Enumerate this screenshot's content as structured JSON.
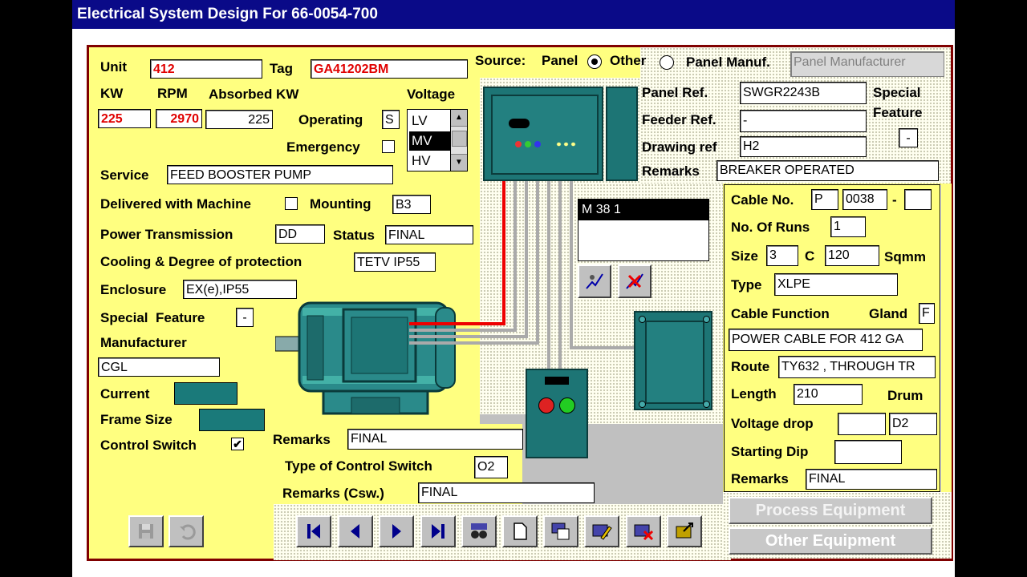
{
  "window": {
    "title": "Electrical System Design For 66-0054-700"
  },
  "motor": {
    "unit_label": "Unit",
    "unit": "412",
    "tag_label": "Tag",
    "tag": "GA41202BM",
    "kw_label": "KW",
    "kw": "225",
    "rpm_label": "RPM",
    "rpm": "2970",
    "absorbed_label": "Absorbed KW",
    "absorbed": "225",
    "voltage_label": "Voltage",
    "voltage_options": [
      "LV",
      "MV",
      "HV"
    ],
    "voltage_selected": "MV",
    "operating_label": "Operating",
    "operating": "S",
    "emergency_label": "Emergency",
    "service_label": "Service",
    "service": "FEED BOOSTER PUMP",
    "delivered_label": "Delivered with Machine",
    "mounting_label": "Mounting",
    "mounting": "B3",
    "power_trans_label": "Power Transmission",
    "power_trans": "DD",
    "status_label": "Status",
    "status": "FINAL",
    "cooling_label": "Cooling & Degree of protection",
    "cooling": "TETV IP55",
    "enclosure_label": "Enclosure",
    "enclosure": "EX(e),IP55",
    "special_feature_label": "Special  Feature",
    "special_feature": "-",
    "manufacturer_label": "Manufacturer",
    "manufacturer": "CGL",
    "current_label": "Current",
    "frame_size_label": "Frame Size",
    "control_switch_label": "Control Switch",
    "control_switch_checked": "✔",
    "remarks_label": "Remarks",
    "remarks": "FINAL",
    "type_csw_label": "Type of Control Switch",
    "type_csw": "O2",
    "remarks_csw_label": "Remarks (Csw.)",
    "remarks_csw": "FINAL"
  },
  "source": {
    "label": "Source:",
    "panel_label": "Panel",
    "other_label": "Other",
    "selected": "Panel",
    "panel_manuf_label": "Panel Manuf.",
    "panel_manuf_placeholder": "Panel Manufacturer"
  },
  "panel": {
    "panel_ref_label": "Panel Ref.",
    "panel_ref": "SWGR2243B",
    "feeder_ref_label": "Feeder Ref.",
    "feeder_ref": "-",
    "drawing_ref_label": "Drawing ref",
    "drawing_ref": "H2",
    "remarks_label": "Remarks",
    "remarks": "BREAKER OPERATED",
    "special_feature_label_1": "Special",
    "special_feature_label_2": "Feature",
    "special_feature": "-"
  },
  "list": {
    "items": [
      "M 38 1"
    ]
  },
  "cable": {
    "cable_no_label": "Cable No.",
    "cable_no_prefix": "P",
    "cable_no": "0038",
    "cable_no_sep": "-",
    "cable_no_suffix": "",
    "runs_label": "No. Of Runs",
    "runs": "1",
    "size_label": "Size",
    "size_cores": "3",
    "c_label": "C",
    "size_sqmm": "120",
    "sqmm_label": "Sqmm",
    "type_label": "Type",
    "type": "XLPE",
    "function_label": "Cable Function",
    "gland_label": "Gland",
    "gland": "F",
    "function": "POWER CABLE FOR 412 GA",
    "route_label": "Route",
    "route": "TY632 , THROUGH TR",
    "length_label": "Length",
    "length": "210",
    "drum_label": "Drum",
    "vdrop_label": "Voltage drop",
    "vdrop": "",
    "drum": "D2",
    "dip_label": "Starting Dip",
    "dip": "",
    "remarks_label": "Remarks",
    "remarks": "FINAL"
  },
  "buttons": {
    "process_equipment": "Process Equipment",
    "other_equipment": "Other Equipment"
  },
  "colors": {
    "title_bar": "#0a0a88",
    "frame": "#800000",
    "form_bg": "#ffff80",
    "teal": "#1a7a7a",
    "value_red": "#e00000"
  }
}
